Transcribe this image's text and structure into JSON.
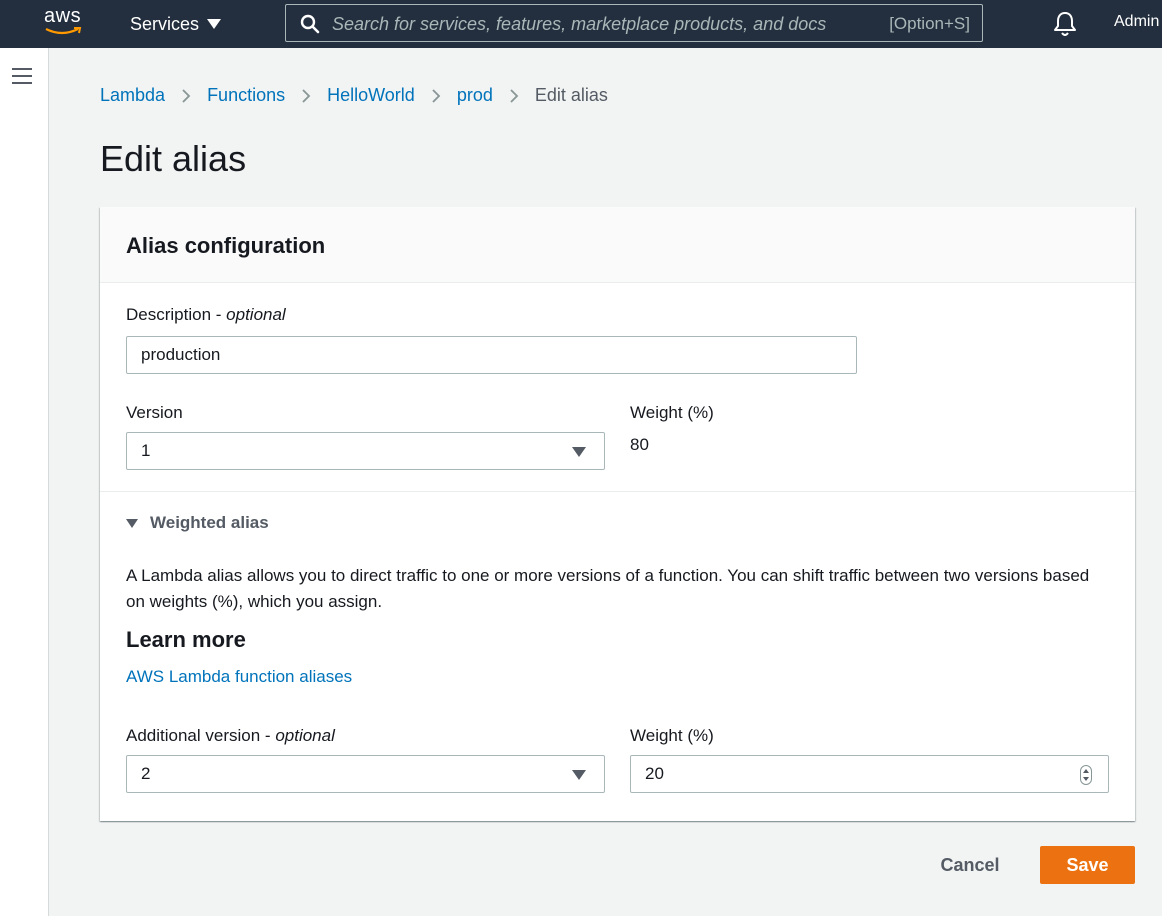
{
  "topnav": {
    "logo_text": "aws",
    "services_label": "Services",
    "search_placeholder": "Search for services, features, marketplace products, and docs",
    "search_shortcut": "[Option+S]",
    "account_label": "Admin"
  },
  "breadcrumb": {
    "items": [
      "Lambda",
      "Functions",
      "HelloWorld",
      "prod"
    ],
    "current": "Edit alias"
  },
  "page": {
    "title": "Edit alias"
  },
  "panel": {
    "title": "Alias configuration",
    "description": {
      "label": "Description",
      "optional": "optional",
      "value": "production"
    },
    "version": {
      "label": "Version",
      "value": "1"
    },
    "weight": {
      "label": "Weight (%)",
      "value": "80"
    },
    "weighted_alias": {
      "toggle_label": "Weighted alias",
      "paragraph": "A Lambda alias allows you to direct traffic to one or more versions of a function. You can shift traffic between two versions based on weights (%), which you assign.",
      "learn_more_heading": "Learn more",
      "doc_link": "AWS Lambda function aliases",
      "additional_version": {
        "label": "Additional version",
        "optional": "optional",
        "value": "2"
      },
      "additional_weight": {
        "label": "Weight (%)",
        "value": "20"
      }
    }
  },
  "actions": {
    "cancel": "Cancel",
    "save": "Save"
  },
  "colors": {
    "nav_bg": "#232f3e",
    "link": "#0073bb",
    "primary_button": "#ec7211",
    "page_bg": "#f2f3f3"
  }
}
